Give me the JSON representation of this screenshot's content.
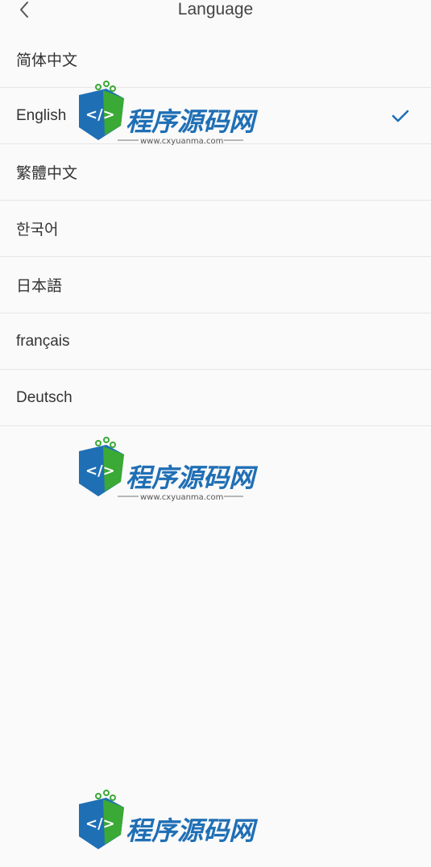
{
  "header": {
    "title": "Language",
    "back_icon": "chevron-left-icon"
  },
  "languages": [
    {
      "label": "简体中文",
      "selected": false
    },
    {
      "label": "English",
      "selected": true
    },
    {
      "label": "繁體中文",
      "selected": false
    },
    {
      "label": "한국어",
      "selected": false
    },
    {
      "label": "日本語",
      "selected": false
    },
    {
      "label": "français",
      "selected": false
    },
    {
      "label": "Deutsch",
      "selected": false
    }
  ],
  "selected_icon": "checkmark-icon",
  "accent_color": "#1e6fb8",
  "watermark": {
    "brand": "程序源码网",
    "url": "www.cxyuanma.com",
    "logo_glyph": "</>"
  }
}
